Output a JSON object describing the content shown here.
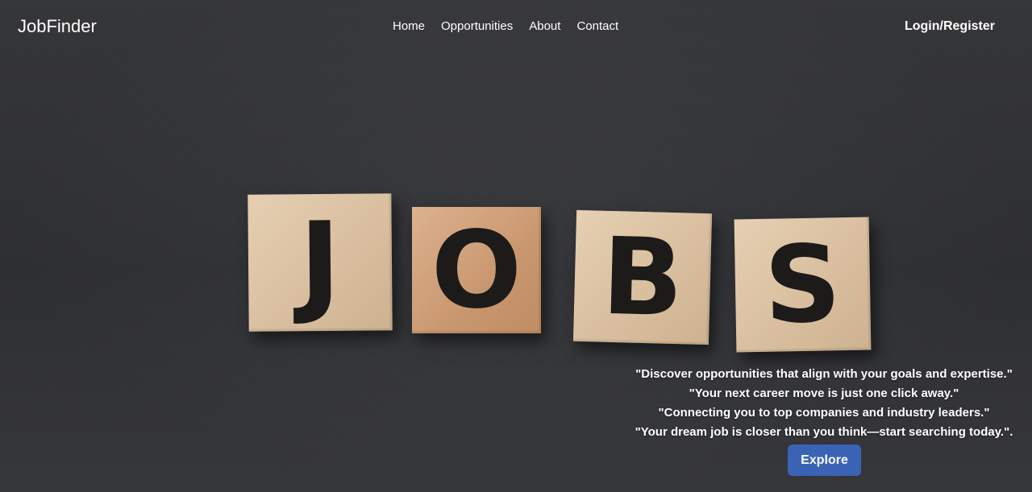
{
  "header": {
    "brand": "JobFinder",
    "nav": [
      "Home",
      "Opportunities",
      "About",
      "Contact"
    ],
    "login_label": "Login/Register"
  },
  "hero": {
    "blocks": [
      "J",
      "O",
      "B",
      "S"
    ],
    "quotes": [
      "\"Discover opportunities that align with your goals and expertise.\"",
      "\"Your next career move is just one click away.\"",
      "\"Connecting you to top companies and industry leaders.\"",
      "\"Your dream job is closer than you think—start searching today.\"."
    ],
    "explore_label": "Explore"
  },
  "colors": {
    "background": "#3c3d3f",
    "text": "#ffffff",
    "button": "#3b63b5",
    "block_wood": "#dcc3a4",
    "letter": "#1c1b1a"
  }
}
